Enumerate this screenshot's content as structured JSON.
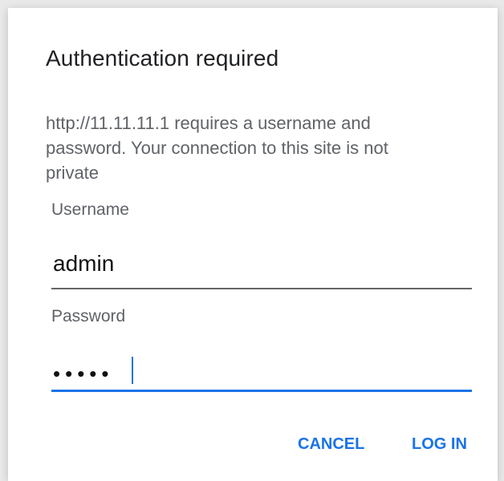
{
  "dialog": {
    "title": "Authentication required",
    "message": "http://11.11.11.1 requires a username and password. Your connection to this site is not private",
    "username_label": "Username",
    "username_value": "admin",
    "password_label": "Password",
    "password_masked": "•••••",
    "cancel_label": "CANCEL",
    "login_label": "LOG IN"
  }
}
